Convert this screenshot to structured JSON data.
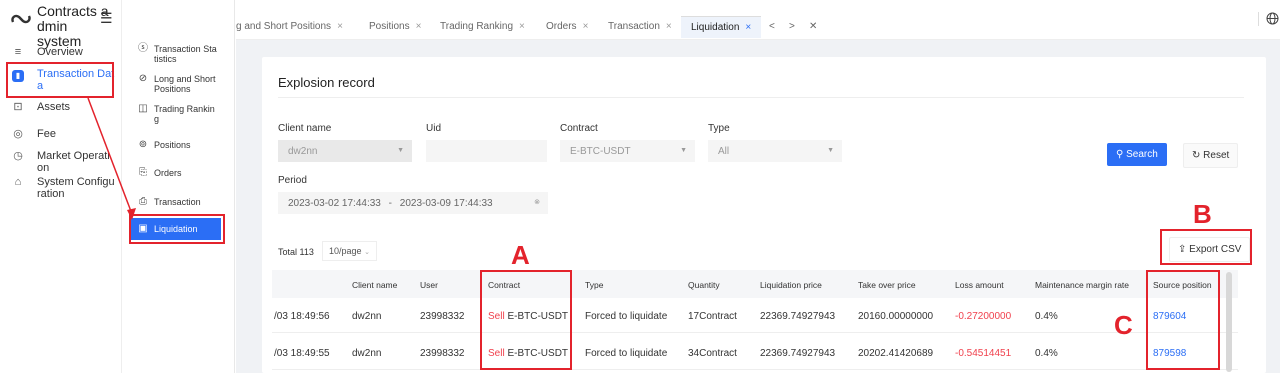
{
  "app": {
    "title": "Contracts admin system",
    "title_line1": "Contracts a",
    "title_line2": "dmin system"
  },
  "sidebar": {
    "items": [
      {
        "icon": "menu-lines-icon",
        "label": "Overview"
      },
      {
        "icon": "bar-chart-icon",
        "label": "Transaction Data",
        "line1": "Transaction Dat",
        "line2": "a",
        "active": true
      },
      {
        "icon": "wallet-icon",
        "label": "Assets"
      },
      {
        "icon": "coin-icon",
        "label": "Fee"
      },
      {
        "icon": "clock-icon",
        "label": "Market Operation",
        "line1": "Market Operati",
        "line2": "on"
      },
      {
        "icon": "briefcase-icon",
        "label": "System Configuration",
        "line1": "System Configu",
        "line2": "ration"
      }
    ]
  },
  "submenu": {
    "items": [
      {
        "icon": "dollar-icon",
        "line1": "Transaction Sta",
        "line2": "tistics"
      },
      {
        "icon": "link-icon",
        "line1": "Long and Short",
        "line2": "Positions"
      },
      {
        "icon": "book-icon",
        "line1": "Trading Rankin",
        "line2": "g"
      },
      {
        "icon": "positions-icon",
        "line1": "Positions",
        "line2": ""
      },
      {
        "icon": "orders-icon",
        "line1": "Orders",
        "line2": ""
      },
      {
        "icon": "transaction-icon",
        "line1": "Transaction",
        "line2": ""
      },
      {
        "icon": "liquidation-icon",
        "line1": "Liquidation",
        "line2": "",
        "active": true
      }
    ]
  },
  "tabs": [
    {
      "label": "g and Short Positions"
    },
    {
      "label": "Positions"
    },
    {
      "label": "Trading Ranking"
    },
    {
      "label": "Orders"
    },
    {
      "label": "Transaction"
    },
    {
      "label": "Liquidation",
      "active": true
    }
  ],
  "tab_nav": {
    "prev": "<",
    "next": ">",
    "close": "✕"
  },
  "page": {
    "title": "Explosion record"
  },
  "filters": {
    "client_name_label": "Client name",
    "client_name_value": "dw2nn",
    "uid_label": "Uid",
    "uid_value": "",
    "contract_label": "Contract",
    "contract_value": "E-BTC-USDT",
    "type_label": "Type",
    "type_value": "All",
    "period_label": "Period",
    "period_start": "2023-03-02 17:44:33",
    "period_sep": "-",
    "period_end": "2023-03-09 17:44:33",
    "search_label": "Search",
    "reset_label": "Reset"
  },
  "pager": {
    "total": "Total 113",
    "page_size": "10/page"
  },
  "export": {
    "label": "Export CSV"
  },
  "table": {
    "headers": [
      "Client name",
      "User",
      "Contract",
      "Type",
      "Quantity",
      "Liquidation price",
      "Take over price",
      "Loss amount",
      "Maintenance margin rate",
      "Source position"
    ],
    "rows": [
      {
        "time": "/03 18:49:56",
        "client": "dw2nn",
        "user": "23998332",
        "side": "Sell",
        "contract": "E-BTC-USDT",
        "type": "Forced to liquidate",
        "quantity": "17Contract",
        "liq_price": "22369.74927943",
        "takeover": "20160.00000000",
        "loss": "-0.27200000",
        "mmr": "0.4%",
        "source": "879604"
      },
      {
        "time": "/03 18:49:55",
        "client": "dw2nn",
        "user": "23998332",
        "side": "Sell",
        "contract": "E-BTC-USDT",
        "type": "Forced to liquidate",
        "quantity": "34Contract",
        "liq_price": "22369.74927943",
        "takeover": "20202.41420689",
        "loss": "-0.54514451",
        "mmr": "0.4%",
        "source": "879598"
      }
    ]
  },
  "annotations": {
    "a": "A",
    "b": "B",
    "c": "C"
  },
  "colors": {
    "accent": "#2b6ef5",
    "annotation": "#e3232c",
    "loss": "#f0414d"
  }
}
